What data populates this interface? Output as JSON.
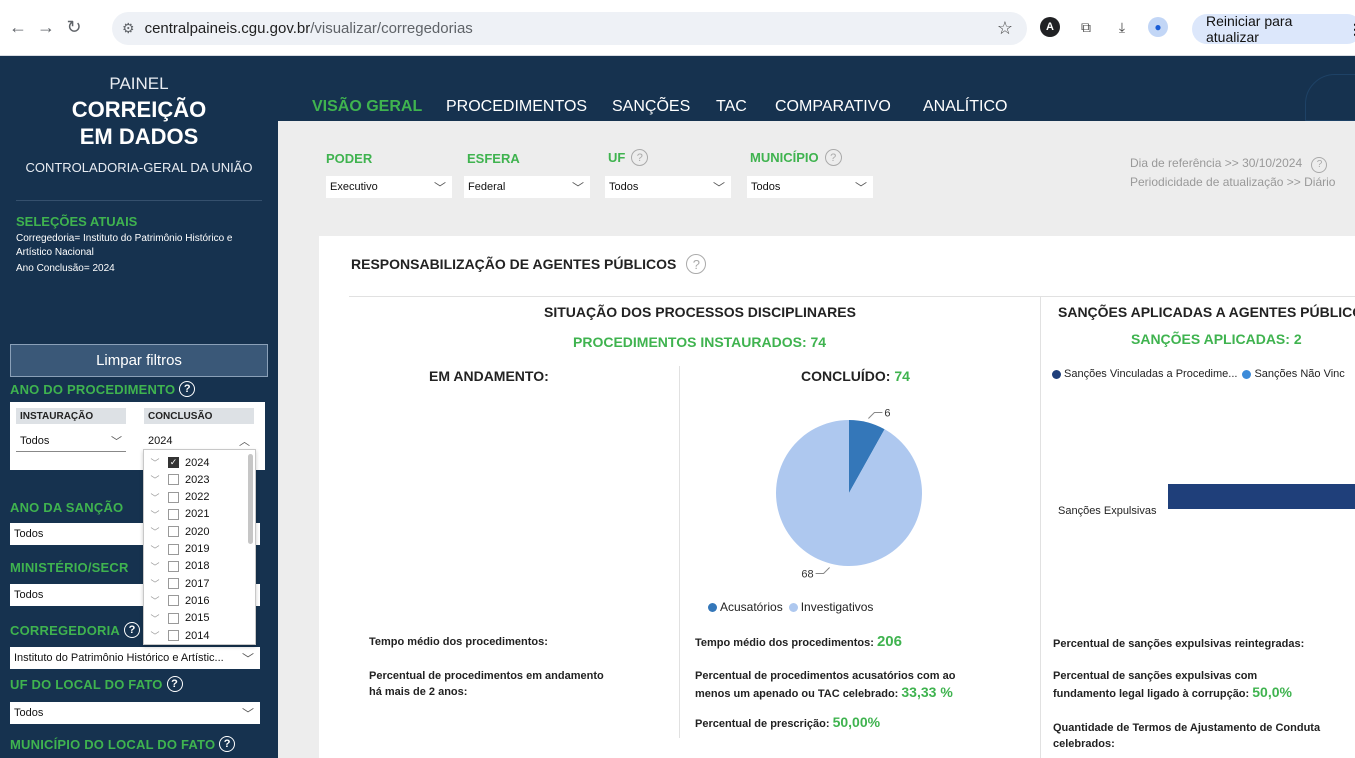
{
  "browser": {
    "url_host": "centralpaineis.cgu.gov.br",
    "url_path": "/visualizar/corregedorias",
    "update_button": "Reiniciar para atualizar"
  },
  "sidebar": {
    "painel": "PAINEL",
    "title_line1": "CORREIÇÃO",
    "title_line2": "EM DADOS",
    "org": "CONTROLADORIA-GERAL DA UNIÃO",
    "selections_title": "SELEÇÕES ATUAIS",
    "selections": [
      "Corregedoria= Instituto do Patrimônio Histórico e",
      "Artístico Nacional",
      "Ano Conclusão= 2024"
    ],
    "clear_filters": "Limpar filtros",
    "ano_procedimento": "ANO DO PROCEDIMENTO",
    "instauracao_label": "INSTAURAÇÃO",
    "conclusao_label": "CONCLUSÃO",
    "instauracao_value": "Todos",
    "conclusao_value": "2024",
    "ano_sancao": "ANO DA SANÇÃO",
    "ano_sancao_value": "Todos",
    "ministerio": "MINISTÉRIO/SECR",
    "ministerio_value": "Todos",
    "corregedoria": "CORREGEDORIA",
    "corregedoria_value": "Instituto do Patrimônio Histórico e Artístic...",
    "uf_local": "UF DO LOCAL DO FATO",
    "uf_local_value": "Todos",
    "municipio_local": "MUNICÍPIO DO LOCAL DO FATO"
  },
  "year_dropdown": {
    "items": [
      {
        "year": "2024",
        "checked": true
      },
      {
        "year": "2023",
        "checked": false
      },
      {
        "year": "2022",
        "checked": false
      },
      {
        "year": "2021",
        "checked": false
      },
      {
        "year": "2020",
        "checked": false
      },
      {
        "year": "2019",
        "checked": false
      },
      {
        "year": "2018",
        "checked": false
      },
      {
        "year": "2017",
        "checked": false
      },
      {
        "year": "2016",
        "checked": false
      },
      {
        "year": "2015",
        "checked": false
      },
      {
        "year": "2014",
        "checked": false
      }
    ]
  },
  "nav": {
    "tabs": [
      "VISÃO GERAL",
      "PROCEDIMENTOS",
      "SANÇÕES",
      "TAC",
      "COMPARATIVO",
      "ANALÍTICO"
    ]
  },
  "filters": {
    "poder_label": "PODER",
    "poder_value": "Executivo",
    "esfera_label": "ESFERA",
    "esfera_value": "Federal",
    "uf_label": "UF",
    "uf_value": "Todos",
    "municipio_label": "MUNICÍPIO",
    "municipio_value": "Todos",
    "ref_date": "Dia de referência >> 30/10/2024",
    "periodicity": "Periodicidade de atualização >> Diário"
  },
  "card": {
    "title": "RESPONSABILIZAÇÃO DE AGENTES PÚBLICOS",
    "situacao_title": "SITUAÇÃO DOS PROCESSOS DISCIPLINARES",
    "procedimentos_instaurados": "PROCEDIMENTOS INSTAURADOS: 74",
    "em_andamento": "EM ANDAMENTO:",
    "concluido_label": "CONCLUÍDO:",
    "concluido_value": "74",
    "tempo_medio_andamento": "Tempo médio dos procedimentos:",
    "pct_andamento_line1": "Percentual de procedimentos em andamento",
    "pct_andamento_line2": "há mais de 2 anos:",
    "tempo_medio_concl_label": "Tempo médio dos procedimentos:",
    "tempo_medio_concl_value": "206",
    "pct_acusatorios_line1": "Percentual de procedimentos acusatórios com ao",
    "pct_acusatorios_line2": "menos um apenado ou TAC celebrado:",
    "pct_acusatorios_value": "33,33 %",
    "pct_prescricao_label": "Percentual de prescrição:",
    "pct_prescricao_value": "50,00%",
    "sancoes_title": "SANÇÕES APLICADAS A AGENTES PÚBLICO",
    "sancoes_aplicadas": "SANÇÕES APLICADAS: 2",
    "sancoes_legend_1": "Sanções Vinculadas a Procedime...",
    "sancoes_legend_2": "Sanções Não Vinc",
    "sancoes_expulsivas": "Sanções Expulsivas",
    "pct_reintegradas": "Percentual de sanções expulsivas reintegradas:",
    "pct_corrupcao_line1": "Percentual de sanções expulsivas com",
    "pct_corrupcao_line2": "fundamento legal ligado à corrupção:",
    "pct_corrupcao_value": "50,0%",
    "tac_line1": "Quantidade de Termos de Ajustamento de Conduta",
    "tac_line2": "celebrados:"
  },
  "chart_data": [
    {
      "type": "pie",
      "title": "",
      "categories": [
        "Acusatórios",
        "Investigativos"
      ],
      "values": [
        6,
        68
      ],
      "colors": [
        "#3477b9",
        "#aec8ef"
      ],
      "legend": "bottom"
    },
    {
      "type": "bar",
      "title": "",
      "categories": [
        "Sanções Expulsivas"
      ],
      "series": [
        {
          "name": "Sanções Vinculadas a Procedime...",
          "color": "#1f3f7a"
        },
        {
          "name": "Sanções Não Vinc",
          "color": "#3d8bd9"
        }
      ],
      "legend": "top"
    }
  ],
  "colors": {
    "navy": "#16324f",
    "green": "#3fb34f",
    "pie_dark": "#3477b9",
    "pie_light": "#aec8ef"
  }
}
